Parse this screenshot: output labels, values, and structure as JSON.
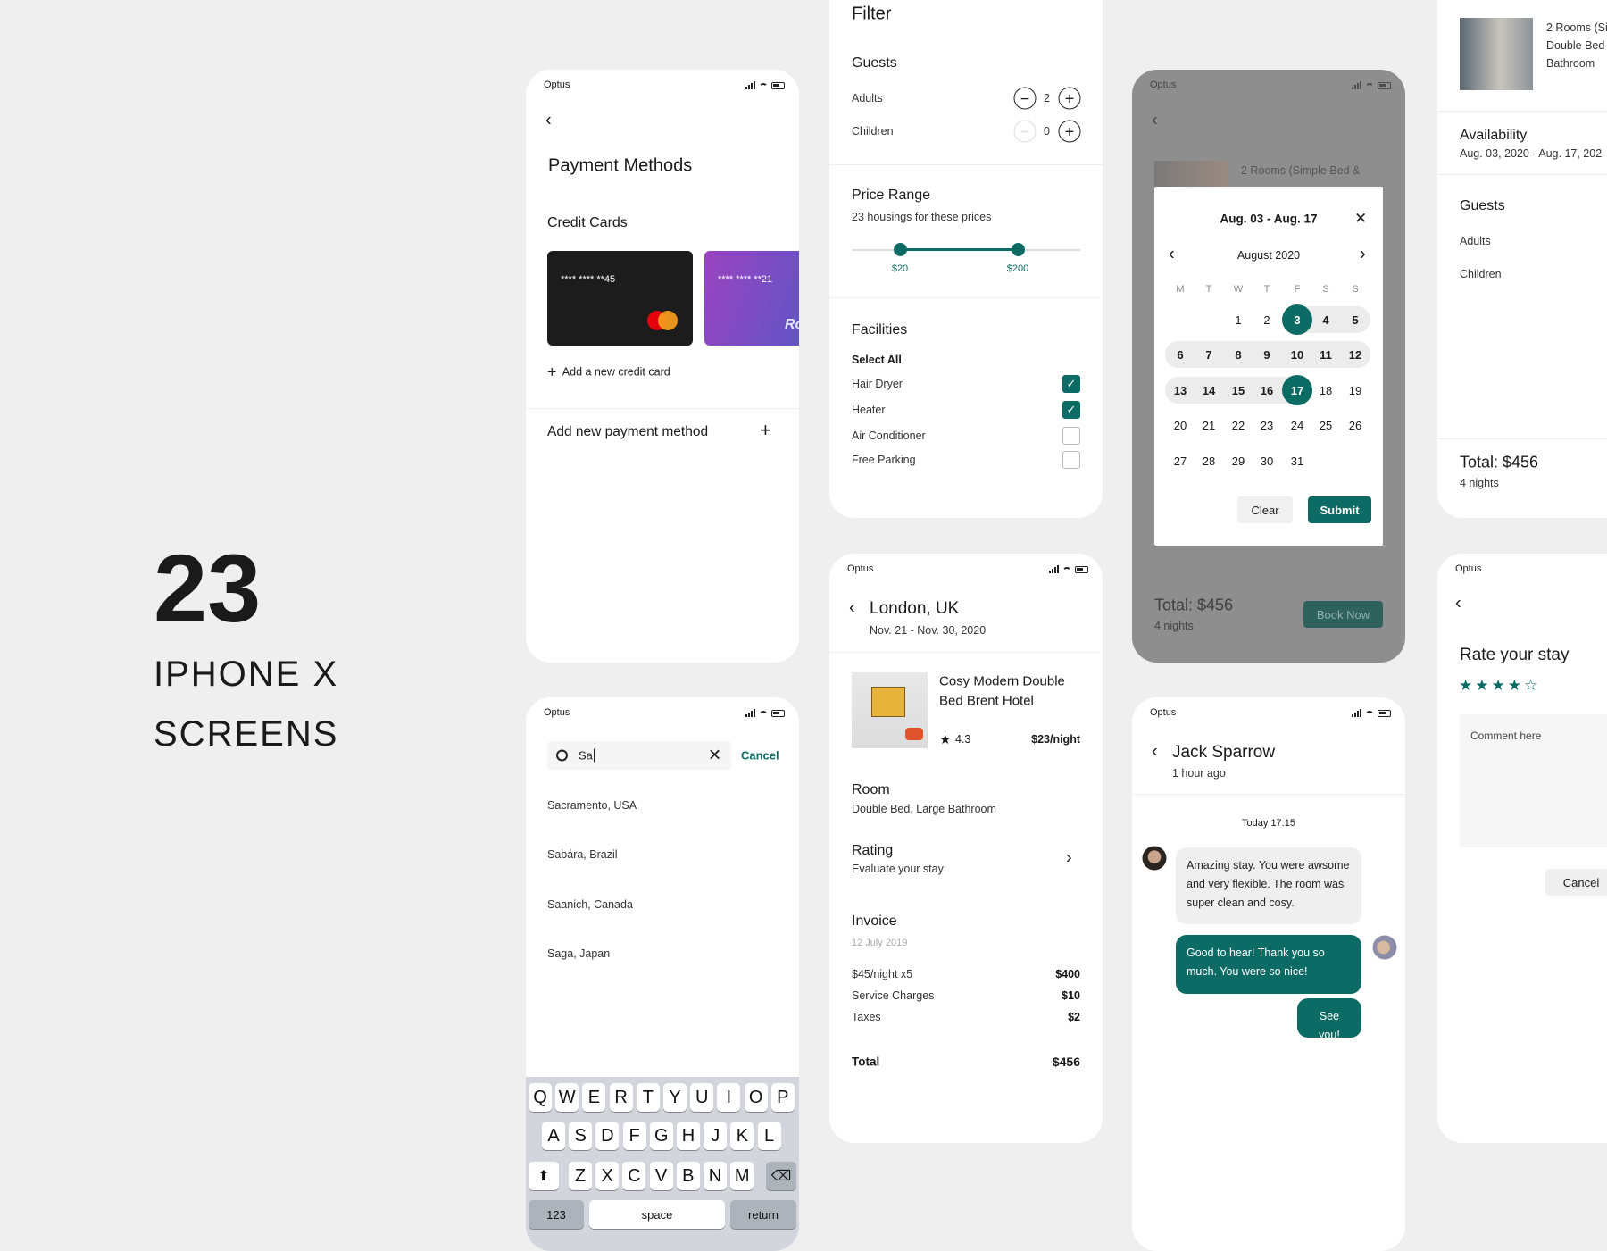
{
  "hero": {
    "count": "23",
    "line1": "IPHONE X",
    "line2": "SCREENS"
  },
  "carrier": "Optus",
  "colors": {
    "accent": "#0d6b65",
    "background": "#efefef"
  },
  "payment": {
    "title": "Payment Methods",
    "section": "Credit Cards",
    "cards": [
      {
        "number": "**** **** **45",
        "brand": "mastercard"
      },
      {
        "number": "**** **** **21",
        "brand": "Ro"
      }
    ],
    "add_card": "Add a new credit card",
    "add_method": "Add new payment method"
  },
  "search": {
    "query": "Sa",
    "cancel": "Cancel",
    "results": [
      "Sacramento, USA",
      "Sabára, Brazil",
      "Saanich, Canada",
      "Saga, Japan"
    ],
    "keyboard": {
      "row1": [
        "Q",
        "W",
        "E",
        "R",
        "T",
        "Y",
        "U",
        "I",
        "O",
        "P"
      ],
      "row2": [
        "A",
        "S",
        "D",
        "F",
        "G",
        "H",
        "J",
        "K",
        "L"
      ],
      "row3": [
        "Z",
        "X",
        "C",
        "V",
        "B",
        "N",
        "M"
      ],
      "numbers": "123",
      "space": "space",
      "return": "return"
    }
  },
  "filter": {
    "title": "Filter",
    "guests_title": "Guests",
    "adults_label": "Adults",
    "adults": "2",
    "children_label": "Children",
    "children": "0",
    "price_title": "Price Range",
    "price_sub": "23 housings for these prices",
    "price_min": "$20",
    "price_max": "$200",
    "facilities_title": "Facilities",
    "select_all": "Select All",
    "facilities": [
      {
        "label": "Hair Dryer",
        "checked": true
      },
      {
        "label": "Heater",
        "checked": true
      },
      {
        "label": "Air Conditioner",
        "checked": false
      },
      {
        "label": "Free Parking",
        "checked": false
      }
    ]
  },
  "booking": {
    "title": "London, UK",
    "dates": "Nov. 21 - Nov. 30, 2020",
    "hotel": "Cosy Modern Double",
    "hotel2": "Bed Brent Hotel",
    "rating": "4.3",
    "price": "$23/night",
    "room_title": "Room",
    "room_sub": "Double Bed, Large Bathroom",
    "rating_title": "Rating",
    "rating_sub": "Evaluate your stay",
    "invoice_title": "Invoice",
    "invoice_date": "12 July 2019",
    "lines": [
      {
        "label": "$45/night x5",
        "value": "$400"
      },
      {
        "label": "Service Charges",
        "value": "$10"
      },
      {
        "label": "Taxes",
        "value": "$2"
      }
    ],
    "total_label": "Total",
    "total": "$456"
  },
  "calendar": {
    "behind_text": "2 Rooms (Simple Bed &",
    "title": "Aug. 03 - Aug. 17",
    "month": "August 2020",
    "weekdays": [
      "M",
      "T",
      "W",
      "T",
      "F",
      "S",
      "S"
    ],
    "weeks": [
      [
        null,
        null,
        1,
        2,
        3,
        4,
        5
      ],
      [
        6,
        7,
        8,
        9,
        10,
        11,
        12
      ],
      [
        13,
        14,
        15,
        16,
        17,
        18,
        19
      ],
      [
        20,
        21,
        22,
        23,
        24,
        25,
        26
      ],
      [
        27,
        28,
        29,
        30,
        31,
        null,
        null
      ]
    ],
    "range_start": 3,
    "range_end": 17,
    "clear": "Clear",
    "submit": "Submit",
    "total": "Total: $456",
    "nights": "4 nights",
    "book": "Book Now"
  },
  "chat": {
    "name": "Jack Sparrow",
    "status": "1 hour ago",
    "day": "Today 17:15",
    "messages": [
      "Amazing stay. You were awsome and very flexible. The room was super clean and cosy.",
      "Good to hear! Thank you so much. You were so nice!",
      "See you!"
    ]
  },
  "summary": {
    "room": [
      "2 Rooms (Si",
      "Double Bed",
      "Bathroom"
    ],
    "availability_title": "Availability",
    "availability": "Aug. 03, 2020 - Aug. 17, 202",
    "guests_title": "Guests",
    "adults_label": "Adults",
    "children_label": "Children",
    "total": "Total: $456",
    "nights": "4 nights"
  },
  "rate": {
    "title": "Rate your stay",
    "stars": 4,
    "max_stars": 5,
    "placeholder": "Comment here",
    "cancel": "Cancel"
  }
}
